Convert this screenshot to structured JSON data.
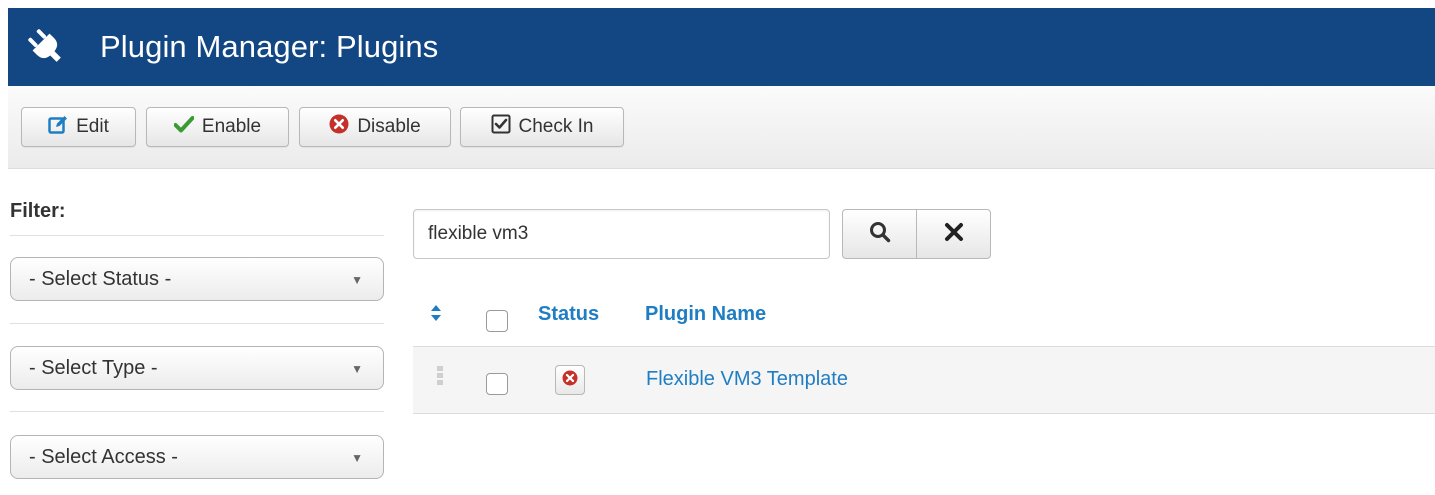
{
  "header": {
    "title": "Plugin Manager: Plugins",
    "icon": "plug-icon"
  },
  "toolbar": {
    "edit_label": "Edit",
    "enable_label": "Enable",
    "disable_label": "Disable",
    "checkin_label": "Check In"
  },
  "filter": {
    "title": "Filter:",
    "status_select": "- Select Status -",
    "type_select": "- Select Type -",
    "access_select": "- Select Access -"
  },
  "search": {
    "value": "flexible vm3"
  },
  "table": {
    "columns": {
      "status": "Status",
      "name": "Plugin Name"
    },
    "rows": [
      {
        "status": "disabled",
        "name": "Flexible VM3 Template"
      }
    ]
  },
  "colors": {
    "header_bg": "#124783",
    "link": "#1f7ec3",
    "enable": "#3a9a33",
    "disable": "#c5312a"
  }
}
